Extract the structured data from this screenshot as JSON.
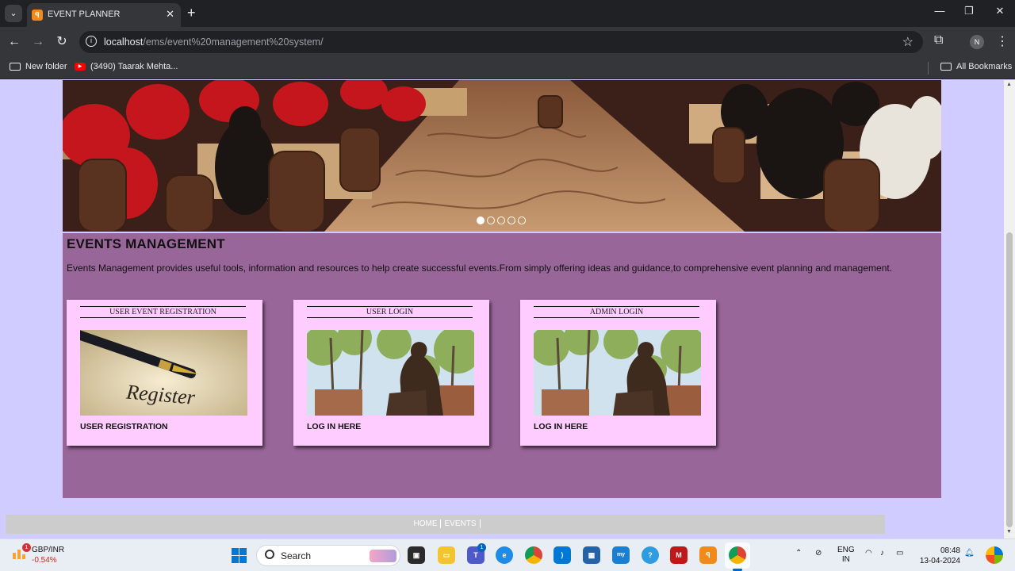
{
  "browser": {
    "tab_title": "EVENT PLANNER",
    "tab_favicon": "xampp-icon",
    "url_host": "localhost",
    "url_path": "/ems/event%20management%20system/",
    "profile_initial": "N",
    "bookmarks": [
      {
        "label": "New folder",
        "icon": "folder-icon"
      },
      {
        "label": "(3490) Taarak Mehta...",
        "icon": "youtube-icon"
      }
    ],
    "all_bookmarks": "All Bookmarks"
  },
  "page": {
    "heading": "EVENTS MANAGEMENT",
    "description": "Events Management provides useful tools, information and resources to help create successful events.From simply offering ideas and guidance,to comprehensive event planning and management.",
    "carousel_slide_count": 5,
    "carousel_active_index": 0,
    "cards": [
      {
        "title": "USER EVENT REGISTRATION",
        "image": "register-pen-image",
        "link": "USER REGISTRATION"
      },
      {
        "title": "USER LOGIN",
        "image": "statue-image",
        "link": "LOG IN HERE"
      },
      {
        "title": "ADMIN LOGIN",
        "image": "statue-image",
        "link": "LOG IN HERE"
      }
    ],
    "footer_nav": [
      "HOME",
      "EVENTS"
    ]
  },
  "taskbar": {
    "weather_badge": "1",
    "ticker_symbol": "GBP/INR",
    "ticker_change": "-0.54%",
    "search_label": "Search",
    "teams_badge": "1",
    "lang_line1": "ENG",
    "lang_line2": "IN",
    "time": "08:48",
    "date": "13-04-2024"
  },
  "colors": {
    "page_background": "#d0ccff",
    "content_background": "#996699",
    "card_background": "#ffccff",
    "footer_background": "#cccccc"
  }
}
